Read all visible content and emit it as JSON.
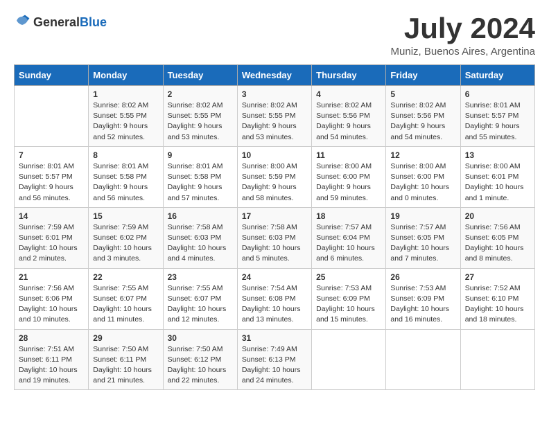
{
  "logo": {
    "general": "General",
    "blue": "Blue"
  },
  "title": {
    "month_year": "July 2024",
    "location": "Muniz, Buenos Aires, Argentina"
  },
  "headers": [
    "Sunday",
    "Monday",
    "Tuesday",
    "Wednesday",
    "Thursday",
    "Friday",
    "Saturday"
  ],
  "weeks": [
    [
      {
        "day": "",
        "info": ""
      },
      {
        "day": "1",
        "info": "Sunrise: 8:02 AM\nSunset: 5:55 PM\nDaylight: 9 hours\nand 52 minutes."
      },
      {
        "day": "2",
        "info": "Sunrise: 8:02 AM\nSunset: 5:55 PM\nDaylight: 9 hours\nand 53 minutes."
      },
      {
        "day": "3",
        "info": "Sunrise: 8:02 AM\nSunset: 5:55 PM\nDaylight: 9 hours\nand 53 minutes."
      },
      {
        "day": "4",
        "info": "Sunrise: 8:02 AM\nSunset: 5:56 PM\nDaylight: 9 hours\nand 54 minutes."
      },
      {
        "day": "5",
        "info": "Sunrise: 8:02 AM\nSunset: 5:56 PM\nDaylight: 9 hours\nand 54 minutes."
      },
      {
        "day": "6",
        "info": "Sunrise: 8:01 AM\nSunset: 5:57 PM\nDaylight: 9 hours\nand 55 minutes."
      }
    ],
    [
      {
        "day": "7",
        "info": "Sunrise: 8:01 AM\nSunset: 5:57 PM\nDaylight: 9 hours\nand 56 minutes."
      },
      {
        "day": "8",
        "info": "Sunrise: 8:01 AM\nSunset: 5:58 PM\nDaylight: 9 hours\nand 56 minutes."
      },
      {
        "day": "9",
        "info": "Sunrise: 8:01 AM\nSunset: 5:58 PM\nDaylight: 9 hours\nand 57 minutes."
      },
      {
        "day": "10",
        "info": "Sunrise: 8:00 AM\nSunset: 5:59 PM\nDaylight: 9 hours\nand 58 minutes."
      },
      {
        "day": "11",
        "info": "Sunrise: 8:00 AM\nSunset: 6:00 PM\nDaylight: 9 hours\nand 59 minutes."
      },
      {
        "day": "12",
        "info": "Sunrise: 8:00 AM\nSunset: 6:00 PM\nDaylight: 10 hours\nand 0 minutes."
      },
      {
        "day": "13",
        "info": "Sunrise: 8:00 AM\nSunset: 6:01 PM\nDaylight: 10 hours\nand 1 minute."
      }
    ],
    [
      {
        "day": "14",
        "info": "Sunrise: 7:59 AM\nSunset: 6:01 PM\nDaylight: 10 hours\nand 2 minutes."
      },
      {
        "day": "15",
        "info": "Sunrise: 7:59 AM\nSunset: 6:02 PM\nDaylight: 10 hours\nand 3 minutes."
      },
      {
        "day": "16",
        "info": "Sunrise: 7:58 AM\nSunset: 6:03 PM\nDaylight: 10 hours\nand 4 minutes."
      },
      {
        "day": "17",
        "info": "Sunrise: 7:58 AM\nSunset: 6:03 PM\nDaylight: 10 hours\nand 5 minutes."
      },
      {
        "day": "18",
        "info": "Sunrise: 7:57 AM\nSunset: 6:04 PM\nDaylight: 10 hours\nand 6 minutes."
      },
      {
        "day": "19",
        "info": "Sunrise: 7:57 AM\nSunset: 6:05 PM\nDaylight: 10 hours\nand 7 minutes."
      },
      {
        "day": "20",
        "info": "Sunrise: 7:56 AM\nSunset: 6:05 PM\nDaylight: 10 hours\nand 8 minutes."
      }
    ],
    [
      {
        "day": "21",
        "info": "Sunrise: 7:56 AM\nSunset: 6:06 PM\nDaylight: 10 hours\nand 10 minutes."
      },
      {
        "day": "22",
        "info": "Sunrise: 7:55 AM\nSunset: 6:07 PM\nDaylight: 10 hours\nand 11 minutes."
      },
      {
        "day": "23",
        "info": "Sunrise: 7:55 AM\nSunset: 6:07 PM\nDaylight: 10 hours\nand 12 minutes."
      },
      {
        "day": "24",
        "info": "Sunrise: 7:54 AM\nSunset: 6:08 PM\nDaylight: 10 hours\nand 13 minutes."
      },
      {
        "day": "25",
        "info": "Sunrise: 7:53 AM\nSunset: 6:09 PM\nDaylight: 10 hours\nand 15 minutes."
      },
      {
        "day": "26",
        "info": "Sunrise: 7:53 AM\nSunset: 6:09 PM\nDaylight: 10 hours\nand 16 minutes."
      },
      {
        "day": "27",
        "info": "Sunrise: 7:52 AM\nSunset: 6:10 PM\nDaylight: 10 hours\nand 18 minutes."
      }
    ],
    [
      {
        "day": "28",
        "info": "Sunrise: 7:51 AM\nSunset: 6:11 PM\nDaylight: 10 hours\nand 19 minutes."
      },
      {
        "day": "29",
        "info": "Sunrise: 7:50 AM\nSunset: 6:11 PM\nDaylight: 10 hours\nand 21 minutes."
      },
      {
        "day": "30",
        "info": "Sunrise: 7:50 AM\nSunset: 6:12 PM\nDaylight: 10 hours\nand 22 minutes."
      },
      {
        "day": "31",
        "info": "Sunrise: 7:49 AM\nSunset: 6:13 PM\nDaylight: 10 hours\nand 24 minutes."
      },
      {
        "day": "",
        "info": ""
      },
      {
        "day": "",
        "info": ""
      },
      {
        "day": "",
        "info": ""
      }
    ]
  ]
}
